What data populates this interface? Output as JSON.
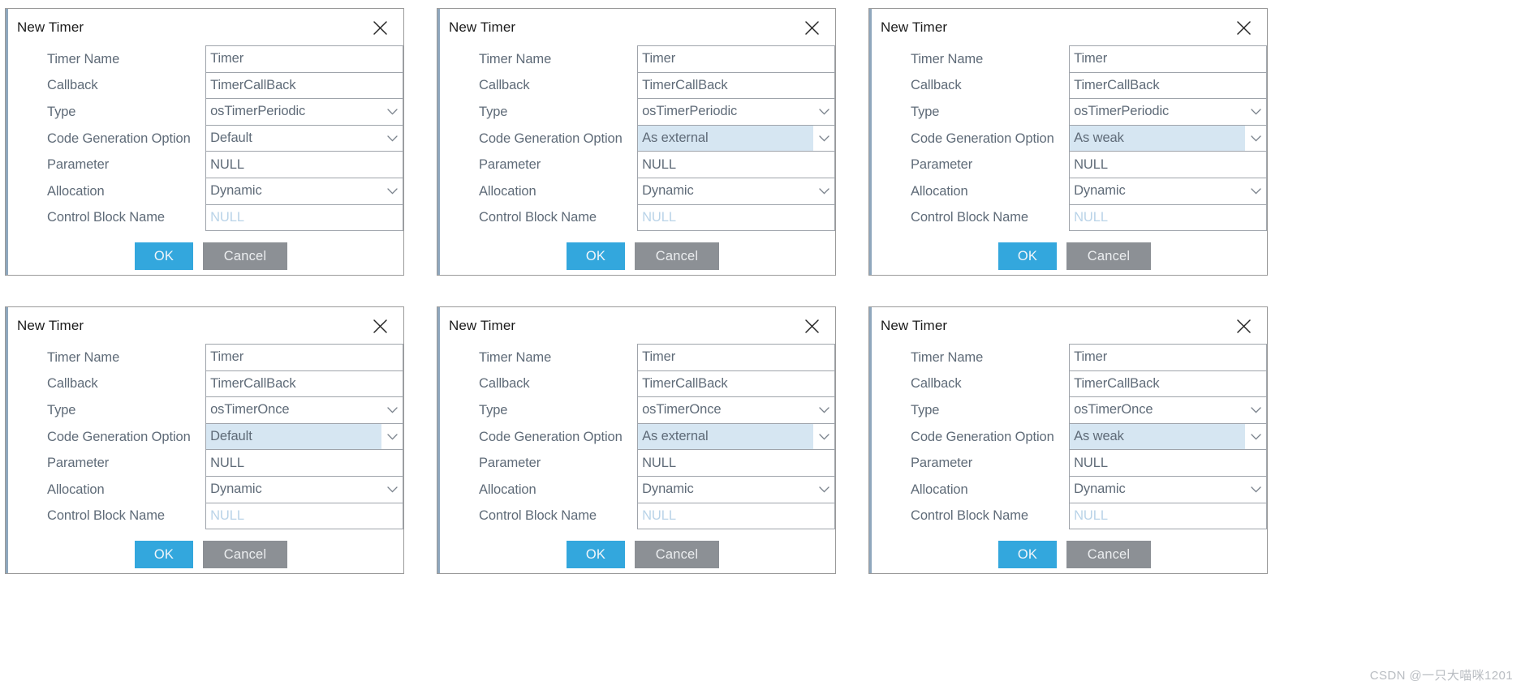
{
  "common": {
    "dialog_title": "New Timer",
    "close_icon": "close-icon",
    "chevron_icon": "chevron-down-icon",
    "ok_label": "OK",
    "cancel_label": "Cancel",
    "labels": {
      "timer_name": "Timer Name",
      "callback": "Callback",
      "type": "Type",
      "code_generation_option": "Code Generation Option",
      "parameter": "Parameter",
      "allocation": "Allocation",
      "control_block_name": "Control Block Name"
    },
    "colors": {
      "ok_button": "#33a7dd",
      "cancel_button": "#8c9095",
      "highlight": "#d6e6f2",
      "label_text": "#5f6b78",
      "placeholder_text": "#b9d3e8",
      "border": "#9fa4ab",
      "accent_bar": "#8fa7bd"
    }
  },
  "watermark": "CSDN @一只大喵咪1201",
  "dialogs": [
    {
      "id": "dialog-periodic-default",
      "title": "New Timer",
      "fields": {
        "timer_name": {
          "value": "Timer",
          "type": "text",
          "highlight": false,
          "placeholder": false
        },
        "callback": {
          "value": "TimerCallBack",
          "type": "text",
          "highlight": false,
          "placeholder": false
        },
        "type": {
          "value": "osTimerPeriodic",
          "type": "select",
          "highlight": false,
          "placeholder": false
        },
        "code_generation_option": {
          "value": "Default",
          "type": "select",
          "highlight": false,
          "placeholder": false
        },
        "parameter": {
          "value": "NULL",
          "type": "text",
          "highlight": false,
          "placeholder": false
        },
        "allocation": {
          "value": "Dynamic",
          "type": "select",
          "highlight": false,
          "placeholder": false
        },
        "control_block_name": {
          "value": "NULL",
          "type": "text",
          "highlight": false,
          "placeholder": true
        }
      }
    },
    {
      "id": "dialog-periodic-as-external",
      "title": "New Timer",
      "fields": {
        "timer_name": {
          "value": "Timer",
          "type": "text",
          "highlight": false,
          "placeholder": false
        },
        "callback": {
          "value": "TimerCallBack",
          "type": "text",
          "highlight": false,
          "placeholder": false
        },
        "type": {
          "value": "osTimerPeriodic",
          "type": "select",
          "highlight": false,
          "placeholder": false
        },
        "code_generation_option": {
          "value": "As external",
          "type": "select",
          "highlight": true,
          "placeholder": false
        },
        "parameter": {
          "value": "NULL",
          "type": "text",
          "highlight": false,
          "placeholder": false
        },
        "allocation": {
          "value": "Dynamic",
          "type": "select",
          "highlight": false,
          "placeholder": false
        },
        "control_block_name": {
          "value": "NULL",
          "type": "text",
          "highlight": false,
          "placeholder": true
        }
      }
    },
    {
      "id": "dialog-periodic-as-weak",
      "title": "New Timer",
      "fields": {
        "timer_name": {
          "value": "Timer",
          "type": "text",
          "highlight": false,
          "placeholder": false
        },
        "callback": {
          "value": "TimerCallBack",
          "type": "text",
          "highlight": false,
          "placeholder": false
        },
        "type": {
          "value": "osTimerPeriodic",
          "type": "select",
          "highlight": false,
          "placeholder": false
        },
        "code_generation_option": {
          "value": "As weak",
          "type": "select",
          "highlight": true,
          "placeholder": false
        },
        "parameter": {
          "value": "NULL",
          "type": "text",
          "highlight": false,
          "placeholder": false
        },
        "allocation": {
          "value": "Dynamic",
          "type": "select",
          "highlight": false,
          "placeholder": false
        },
        "control_block_name": {
          "value": "NULL",
          "type": "text",
          "highlight": false,
          "placeholder": true
        }
      }
    },
    {
      "id": "dialog-once-default",
      "title": "New Timer",
      "fields": {
        "timer_name": {
          "value": "Timer",
          "type": "text",
          "highlight": false,
          "placeholder": false
        },
        "callback": {
          "value": "TimerCallBack",
          "type": "text",
          "highlight": false,
          "placeholder": false
        },
        "type": {
          "value": "osTimerOnce",
          "type": "select",
          "highlight": false,
          "placeholder": false
        },
        "code_generation_option": {
          "value": "Default",
          "type": "select",
          "highlight": true,
          "placeholder": false
        },
        "parameter": {
          "value": "NULL",
          "type": "text",
          "highlight": false,
          "placeholder": false
        },
        "allocation": {
          "value": "Dynamic",
          "type": "select",
          "highlight": false,
          "placeholder": false
        },
        "control_block_name": {
          "value": "NULL",
          "type": "text",
          "highlight": false,
          "placeholder": true
        }
      }
    },
    {
      "id": "dialog-once-as-external",
      "title": "New Timer",
      "fields": {
        "timer_name": {
          "value": "Timer",
          "type": "text",
          "highlight": false,
          "placeholder": false
        },
        "callback": {
          "value": "TimerCallBack",
          "type": "text",
          "highlight": false,
          "placeholder": false
        },
        "type": {
          "value": "osTimerOnce",
          "type": "select",
          "highlight": false,
          "placeholder": false
        },
        "code_generation_option": {
          "value": "As external",
          "type": "select",
          "highlight": true,
          "placeholder": false
        },
        "parameter": {
          "value": "NULL",
          "type": "text",
          "highlight": false,
          "placeholder": false
        },
        "allocation": {
          "value": "Dynamic",
          "type": "select",
          "highlight": false,
          "placeholder": false
        },
        "control_block_name": {
          "value": "NULL",
          "type": "text",
          "highlight": false,
          "placeholder": true
        }
      }
    },
    {
      "id": "dialog-once-as-weak",
      "title": "New Timer",
      "fields": {
        "timer_name": {
          "value": "Timer",
          "type": "text",
          "highlight": false,
          "placeholder": false
        },
        "callback": {
          "value": "TimerCallBack",
          "type": "text",
          "highlight": false,
          "placeholder": false
        },
        "type": {
          "value": "osTimerOnce",
          "type": "select",
          "highlight": false,
          "placeholder": false
        },
        "code_generation_option": {
          "value": "As weak",
          "type": "select",
          "highlight": true,
          "placeholder": false
        },
        "parameter": {
          "value": "NULL",
          "type": "text",
          "highlight": false,
          "placeholder": false
        },
        "allocation": {
          "value": "Dynamic",
          "type": "select",
          "highlight": false,
          "placeholder": false
        },
        "control_block_name": {
          "value": "NULL",
          "type": "text",
          "highlight": false,
          "placeholder": true
        }
      }
    }
  ]
}
